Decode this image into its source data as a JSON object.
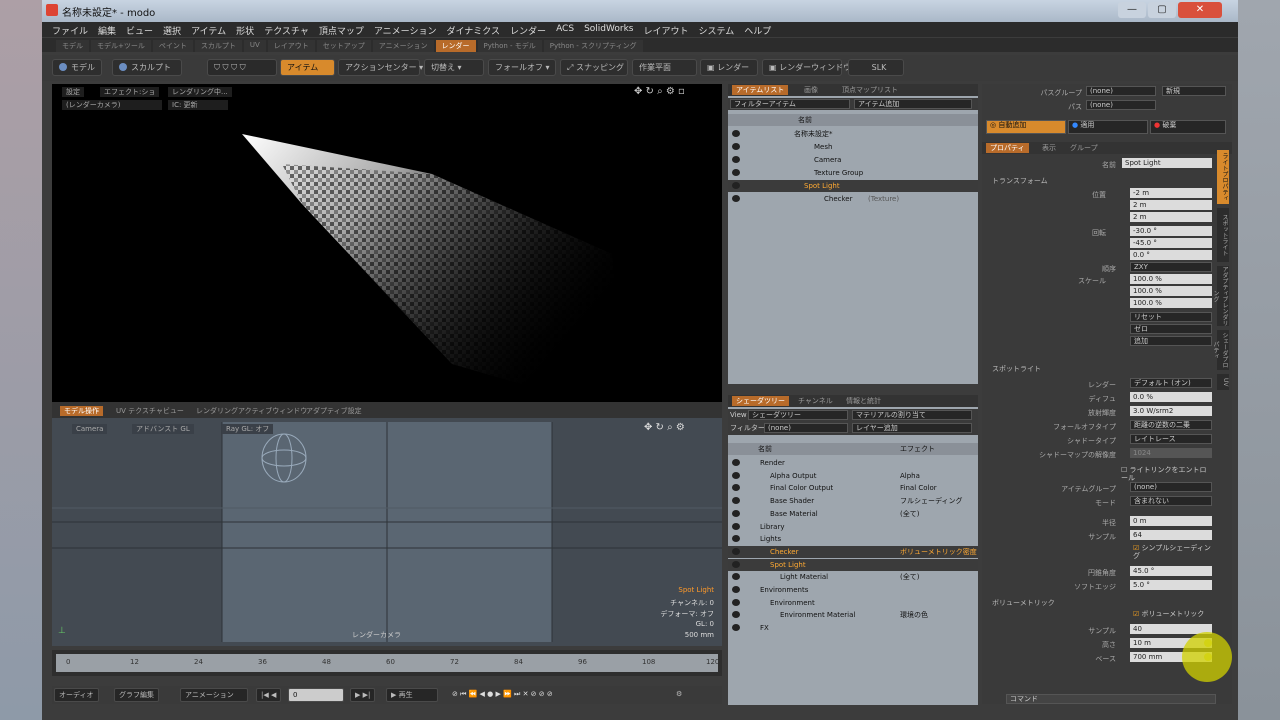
{
  "window": {
    "title": "名称未設定* - modo",
    "controls": [
      "—",
      "▢",
      "✕"
    ]
  },
  "menu": [
    "ファイル",
    "編集",
    "ビュー",
    "選択",
    "アイテム",
    "形状",
    "テクスチャ",
    "頂点マップ",
    "アニメーション",
    "ダイナミクス",
    "レンダー",
    "ACS",
    "SolidWorks",
    "レイアウト",
    "システム",
    "ヘルプ"
  ],
  "layout_tabs": [
    {
      "label": "モデル",
      "active": false
    },
    {
      "label": "モデル+ツール",
      "active": false
    },
    {
      "label": "ペイント",
      "active": false
    },
    {
      "label": "スカルプト",
      "active": false
    },
    {
      "label": "UV",
      "active": false
    },
    {
      "label": "レイアウト",
      "active": false
    },
    {
      "label": "セットアップ",
      "active": false
    },
    {
      "label": "アニメーション",
      "active": false
    },
    {
      "label": "レンダー",
      "active": true
    },
    {
      "label": "Python - モデル",
      "active": false
    },
    {
      "label": "Python - スクリプティング",
      "active": false
    }
  ],
  "toolbar": {
    "model": "モデル",
    "sculpt": "スカルプト",
    "item": "アイテム",
    "action_center": "アクションセンター ▾",
    "falloff": "フォールオフ ▾",
    "snapping": "スナッピング",
    "work_plane": "作業平面",
    "render": "レンダー",
    "render_window": "レンダーウィンドウ",
    "slk": "SLK",
    "shift": "切替え ▾"
  },
  "viewport_top": {
    "tags": [
      "設定",
      "エフェクト:ショ",
      "レンダリング中...",
      "(レンダーカメラ)",
      "IC: 更新"
    ]
  },
  "viewport_tabs": [
    "モデル操作",
    "UV テクスチャビュー",
    "レンダリングアクティブウィンドウ",
    "アダプティブ設定"
  ],
  "viewport_bottom": {
    "labels": [
      "Camera",
      "アドバンスト GL",
      "Ray GL: オフ"
    ],
    "info": [
      "Spot Light",
      "チャンネル: 0",
      "デフォーマ: オフ",
      "GL: 0",
      "500 mm"
    ],
    "camera_label": "レンダーカメラ"
  },
  "timeline": {
    "ticks": [
      "0",
      "12",
      "24",
      "36",
      "48",
      "60",
      "72",
      "84",
      "96",
      "108",
      "120"
    ],
    "marker": "60"
  },
  "bottom_bar": {
    "audio": "オーディオ",
    "graph": "グラフ編集",
    "anim": "アニメーション",
    "frame": "0",
    "play": "再生"
  },
  "item_list": {
    "tabs": [
      "アイテムリスト",
      "画像",
      "頂点マップリスト"
    ],
    "filter": "フィルターアイテム",
    "add_item": "アイテム追加",
    "col_name": "名前",
    "rows": [
      {
        "label": "名称未設定*",
        "indent": 0,
        "selected": false
      },
      {
        "label": "Mesh",
        "indent": 2,
        "selected": false
      },
      {
        "label": "Camera",
        "indent": 2,
        "selected": false
      },
      {
        "label": "Texture Group",
        "indent": 2,
        "selected": false
      },
      {
        "label": "Spot Light",
        "indent": 1,
        "selected": true
      },
      {
        "label": "Checker",
        "indent": 3,
        "selected": false,
        "suffix": "(Texture)"
      }
    ]
  },
  "shader": {
    "tabs": [
      "シェーダツリー",
      "チャンネル",
      "情報と統計"
    ],
    "view_label": "View",
    "view_value": "シェーダツリー",
    "material_assign": "マテリアルの割り当て",
    "filter_label": "フィルター",
    "filter_value": "(none)",
    "add_layer": "レイヤー追加",
    "col_name": "名前",
    "col_effect": "エフェクト",
    "rows": [
      {
        "label": "Render",
        "effect": "",
        "indent": 1,
        "selected": false
      },
      {
        "label": "Alpha Output",
        "effect": "Alpha",
        "indent": 2,
        "selected": false
      },
      {
        "label": "Final Color Output",
        "effect": "Final Color",
        "indent": 2,
        "selected": false
      },
      {
        "label": "Base Shader",
        "effect": "フルシェーディング",
        "indent": 2,
        "selected": false
      },
      {
        "label": "Base Material",
        "effect": "(全て)",
        "indent": 2,
        "selected": false
      },
      {
        "label": "Library",
        "effect": "",
        "indent": 1,
        "selected": false
      },
      {
        "label": "Lights",
        "effect": "",
        "indent": 1,
        "selected": false
      },
      {
        "label": "Checker",
        "effect": "ボリューメトリック密度",
        "indent": 2,
        "selected": true
      },
      {
        "label": "Spot Light",
        "effect": "",
        "indent": 2,
        "selected": true
      },
      {
        "label": "Light Material",
        "effect": "(全て)",
        "indent": 3,
        "selected": false
      },
      {
        "label": "Environments",
        "effect": "",
        "indent": 1,
        "selected": false
      },
      {
        "label": "Environment",
        "effect": "",
        "indent": 2,
        "selected": false
      },
      {
        "label": "Environment Material",
        "effect": "環境の色",
        "indent": 3,
        "selected": false
      },
      {
        "label": "FX",
        "effect": "",
        "indent": 1,
        "selected": false
      }
    ]
  },
  "props": {
    "top": {
      "pass_group": "パスグループ",
      "pass": "パス",
      "pass_group_val": "(none)",
      "pass_val": "(none)",
      "edit": "新規",
      "auto_add": "自動追加",
      "apply": "適用",
      "delete": "破棄"
    },
    "tabs": [
      "プロパティ",
      "表示",
      "グループ"
    ],
    "name_label": "名前",
    "name_value": "Spot Light",
    "transform_title": "トランスフォーム",
    "position_label": "位置",
    "pos": [
      "-2 m",
      "2 m",
      "2 m"
    ],
    "rotation_label": "回転",
    "rot": [
      "-30.0 °",
      "-45.0 °",
      "0.0 °"
    ],
    "order_label": "順序",
    "order": "ZXY",
    "scale_label": "スケール",
    "scale": [
      "100.0 %",
      "100.0 %",
      "100.0 %"
    ],
    "reset": "リセット",
    "zero": "ゼロ",
    "add": "追加",
    "spot_title": "スポットライト",
    "render_label": "レンダー",
    "render_val": "デフォルト (オン)",
    "diffuse_label": "ディフュ",
    "diffuse_val": "0.0 %",
    "radiance_label": "放射輝度",
    "radiance_val": "3.0 W/srm2",
    "falloff_label": "フォールオフタイプ",
    "falloff_val": "距離の逆数の二乗",
    "shadow_label": "シャドータイプ",
    "shadow_val": "レイトレース",
    "shadowmap_label": "シャドーマップの解像度",
    "shadowmap_val": "1024",
    "linking": "ライトリンクをエントロール",
    "item_group_label": "アイテムグループ",
    "item_group_val": "(none)",
    "mode_label": "モード",
    "mode_val": "含まれない",
    "radius_label": "半径",
    "radius_val": "0 m",
    "samples_label": "サンプル",
    "samples_val": "64",
    "simple_shading": "シンプルシェーディング",
    "cone_label": "円錐角度",
    "cone_val": "45.0 °",
    "soft_label": "ソフトエッジ",
    "soft_val": "5.0 °",
    "vol_title": "ボリューメトリック",
    "volumetrics": "ボリューメトリック",
    "vsample_label": "サンプル",
    "vsample_val": "40",
    "height_label": "高さ",
    "height_val": "10 m",
    "base_label": "ベース",
    "base_val": "700 mm",
    "command": "コマンド",
    "side_tabs": [
      "ライトプロパティ",
      "スポットライト",
      "アダプティブレンダリング",
      "シェーダプロパティ",
      "UV"
    ]
  }
}
